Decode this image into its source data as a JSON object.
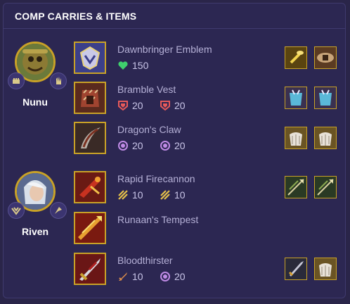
{
  "header": {
    "title": "COMP CARRIES & ITEMS"
  },
  "champions": [
    {
      "name": "Nunu",
      "items": [
        {
          "name": "Dawnbringer Emblem",
          "stats": [
            {
              "icon": "health-heart-icon",
              "value": "150"
            }
          ],
          "components": [
            "golden-spatula-icon",
            "belt-icon"
          ]
        },
        {
          "name": "Bramble Vest",
          "stats": [
            {
              "icon": "armor-icon",
              "value": "20"
            },
            {
              "icon": "armor-icon",
              "value": "20"
            }
          ],
          "components": [
            "chain-vest-icon",
            "chain-vest-icon"
          ]
        },
        {
          "name": "Dragon's Claw",
          "stats": [
            {
              "icon": "magic-resist-icon",
              "value": "20"
            },
            {
              "icon": "magic-resist-icon",
              "value": "20"
            }
          ],
          "components": [
            "negatron-cloak-icon",
            "negatron-cloak-icon"
          ]
        }
      ]
    },
    {
      "name": "Riven",
      "items": [
        {
          "name": "Rapid Firecannon",
          "stats": [
            {
              "icon": "attack-speed-icon",
              "value": "10"
            },
            {
              "icon": "attack-speed-icon",
              "value": "10"
            }
          ],
          "components": [
            "recurve-bow-icon",
            "recurve-bow-icon"
          ]
        },
        {
          "name": "Runaan's Tempest",
          "stats": [],
          "components": []
        },
        {
          "name": "Bloodthirster",
          "stats": [
            {
              "icon": "attack-damage-icon",
              "value": "10"
            },
            {
              "icon": "magic-resist-icon",
              "value": "20"
            }
          ],
          "components": [
            "bf-sword-icon",
            "negatron-cloak-icon"
          ]
        }
      ]
    }
  ],
  "colors": {
    "accent_gold": "#c9a227",
    "health": "#3fcf6d",
    "armor": "#e85a5a",
    "magic_resist": "#c08be6",
    "attack_speed": "#e6c14a",
    "attack_damage": "#e0904a"
  }
}
